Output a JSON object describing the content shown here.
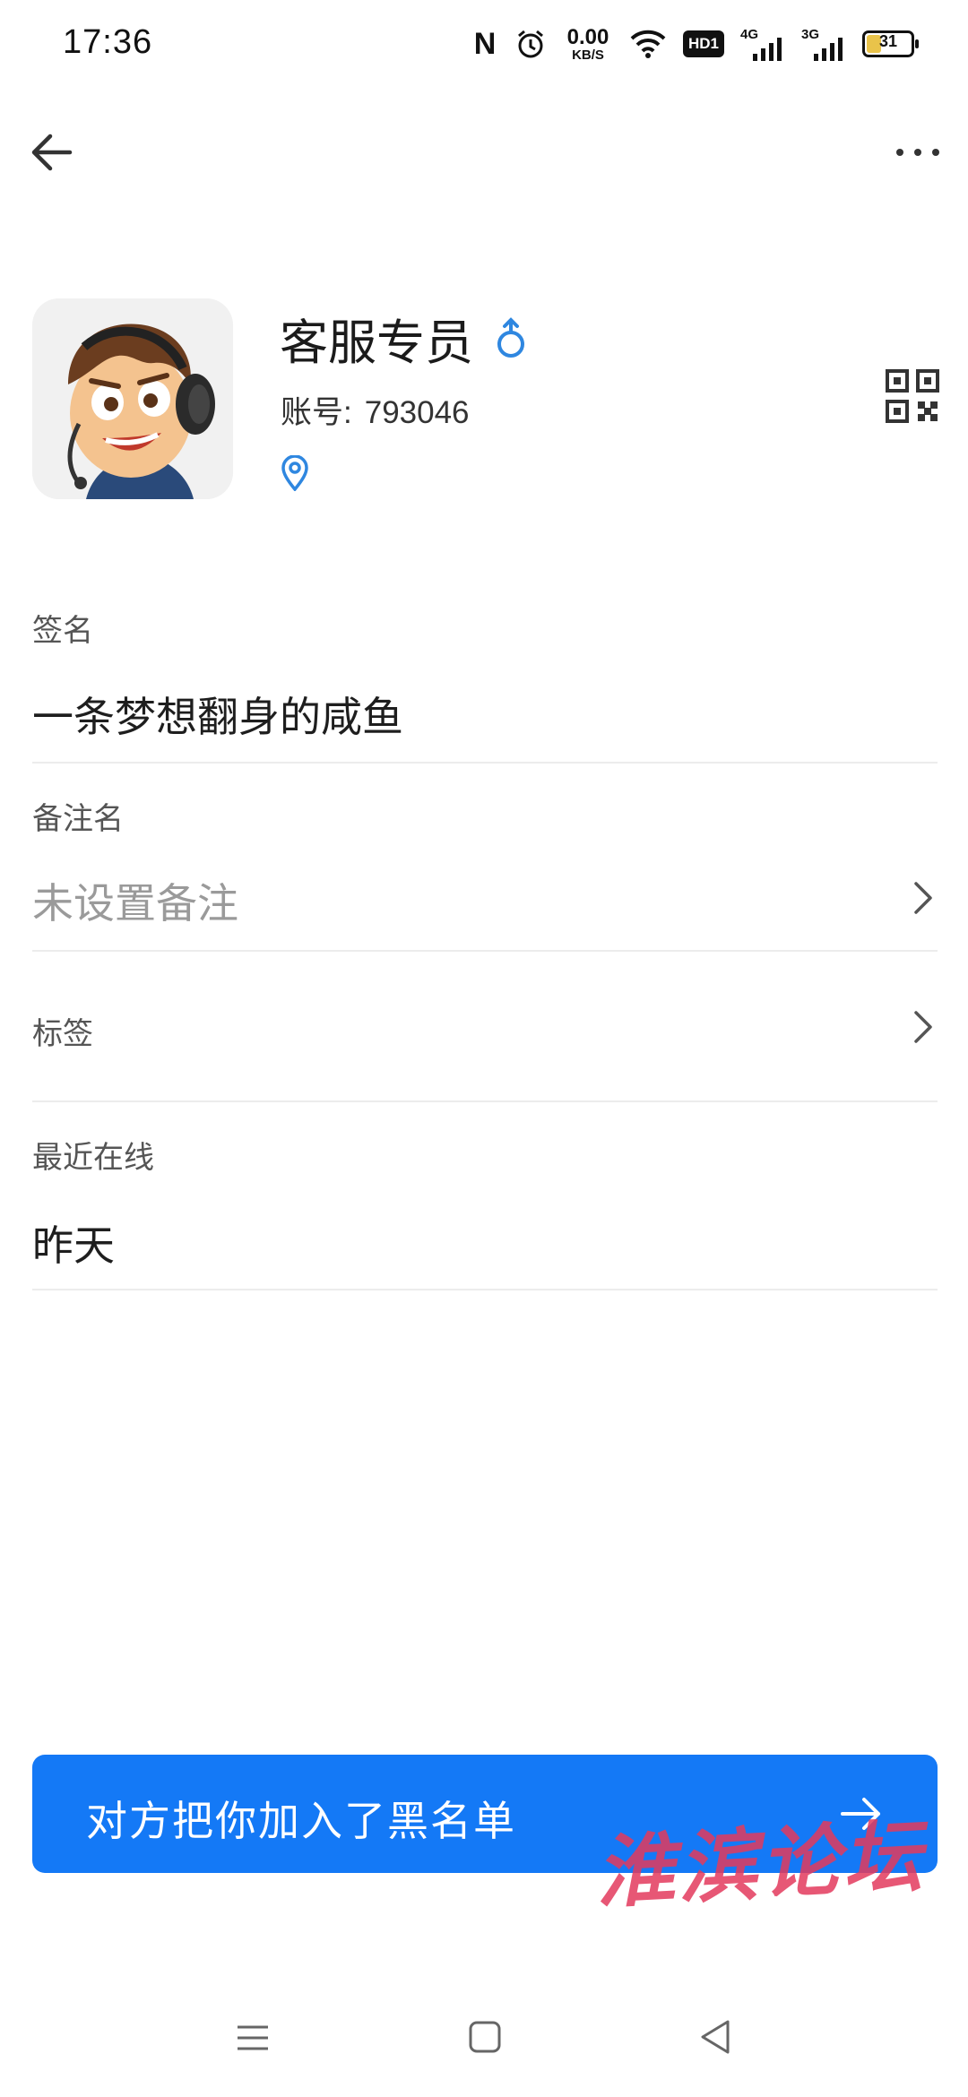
{
  "status_bar": {
    "time": "17:36",
    "net_speed_value": "0.00",
    "net_speed_unit": "KB/S",
    "hd_badge": "HD1",
    "signal_1_gen": "4G",
    "signal_2_gen": "3G",
    "battery_level": "31",
    "icons": [
      "nfc-icon",
      "alarm-icon",
      "wifi-icon",
      "hd-icon",
      "signal-icon",
      "battery-icon"
    ]
  },
  "nav": {
    "back_icon": "arrow-left-icon",
    "more_icon": "more-horizontal-icon"
  },
  "profile": {
    "name": "客服专员",
    "gender_icon": "male-icon",
    "gender_color": "#2f87e0",
    "account_label": "账号:",
    "account_value": "793046",
    "location_icon": "location-pin-icon",
    "qr_icon": "qr-code-icon"
  },
  "fields": {
    "signature": {
      "label": "签名",
      "value": "一条梦想翻身的咸鱼"
    },
    "remark": {
      "label": "备注名",
      "placeholder": "未设置备注"
    },
    "tags": {
      "label": "标签"
    },
    "last_online": {
      "label": "最近在线",
      "value": "昨天"
    }
  },
  "blocked_banner": {
    "text": "对方把你加入了黑名单",
    "color": "#1479f6",
    "arrow_icon": "arrow-right-icon"
  },
  "watermark": {
    "text": "淮滨论坛"
  },
  "system_nav": {
    "icons": [
      "menu-icon",
      "home-square-icon",
      "back-triangle-icon"
    ]
  }
}
